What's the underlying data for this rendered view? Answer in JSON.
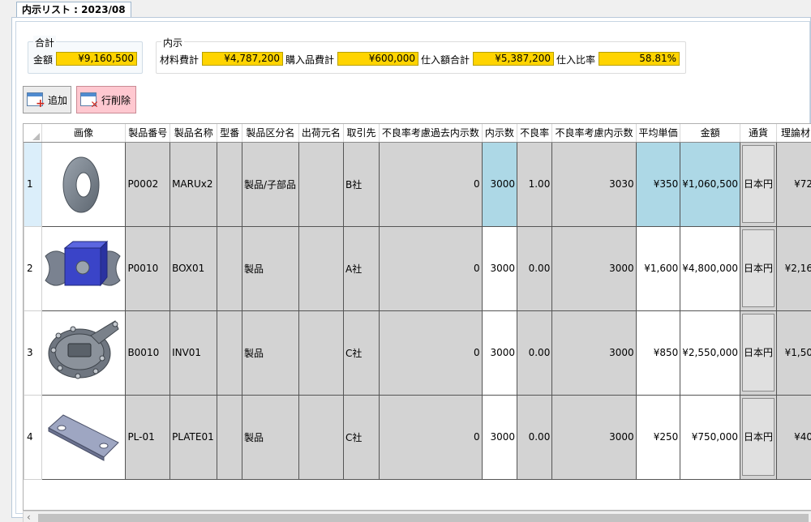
{
  "tab": {
    "title": "内示リスト : 2023/08"
  },
  "totals": {
    "group_title": "合計",
    "amount_label": "金額",
    "amount_value": "¥9,160,500"
  },
  "naiji": {
    "group_title": "内示",
    "material_label": "材料費計",
    "material_value": "¥4,787,200",
    "purchase_label": "購入品費計",
    "purchase_value": "¥600,000",
    "shiire_label": "仕入額合計",
    "shiire_value": "¥5,387,200",
    "ratio_label": "仕入比率",
    "ratio_value": "58.81%"
  },
  "buttons": {
    "add": "追加",
    "delete": "行削除"
  },
  "grid": {
    "columns": [
      "画像",
      "製品番号",
      "製品名称",
      "型番",
      "製品区分名",
      "出荷元名",
      "取引先",
      "不良率考慮過去内示数",
      "内示数",
      "不良率",
      "不良率考慮内示数",
      "平均単価",
      "金額",
      "通貨",
      "理論材"
    ],
    "rows": [
      {
        "no": "1",
        "image": "washer",
        "code": "P0002",
        "name": "MARUx2",
        "model": "",
        "category": "製品/子部品",
        "ship_from": "",
        "partner": "B社",
        "past_qty": "0",
        "qty": "3000",
        "defect": "1.00",
        "adj_qty": "3030",
        "unit_price": "¥350",
        "amount": "¥1,060,500",
        "currency": "日本円",
        "theory": "¥72"
      },
      {
        "no": "2",
        "image": "box-part",
        "code": "P0010",
        "name": "BOX01",
        "model": "",
        "category": "製品",
        "ship_from": "",
        "partner": "A社",
        "past_qty": "0",
        "qty": "3000",
        "defect": "0.00",
        "adj_qty": "3000",
        "unit_price": "¥1,600",
        "amount": "¥4,800,000",
        "currency": "日本円",
        "theory": "¥2,16"
      },
      {
        "no": "3",
        "image": "housing-cover",
        "code": "B0010",
        "name": "INV01",
        "model": "",
        "category": "製品",
        "ship_from": "",
        "partner": "C社",
        "past_qty": "0",
        "qty": "3000",
        "defect": "0.00",
        "adj_qty": "3000",
        "unit_price": "¥850",
        "amount": "¥2,550,000",
        "currency": "日本円",
        "theory": "¥1,50"
      },
      {
        "no": "4",
        "image": "plate",
        "code": "PL-01",
        "name": "PLATE01",
        "model": "",
        "category": "製品",
        "ship_from": "",
        "partner": "C社",
        "past_qty": "0",
        "qty": "3000",
        "defect": "0.00",
        "adj_qty": "3000",
        "unit_price": "¥250",
        "amount": "¥750,000",
        "currency": "日本円",
        "theory": "¥40"
      }
    ]
  },
  "colors": {
    "highlight_yellow": "#ffd400",
    "selected_blue": "#add8e6",
    "delete_pink": "#ffc8d0"
  }
}
